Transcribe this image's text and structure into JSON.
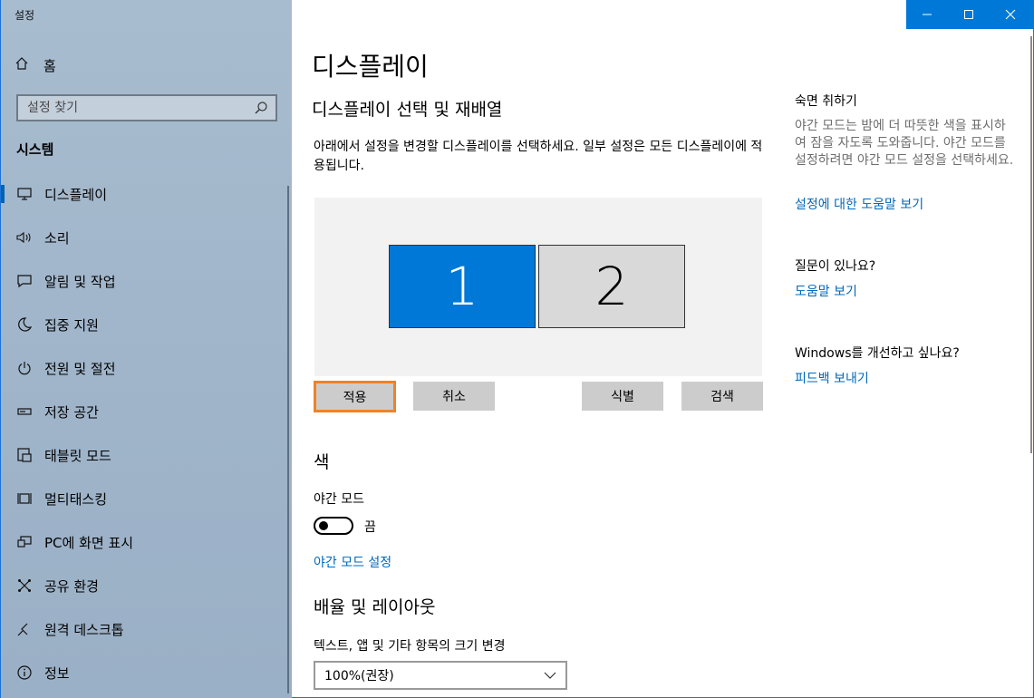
{
  "window": {
    "title": "설정",
    "controls": {
      "minimize": "—",
      "maximize": "☐",
      "close": "✕"
    }
  },
  "sidebar": {
    "home_label": "홈",
    "search_placeholder": "설정 찾기",
    "section_title": "시스템",
    "items": [
      {
        "label": "디스플레이",
        "icon": "monitor-icon",
        "active": true
      },
      {
        "label": "소리",
        "icon": "speaker-icon"
      },
      {
        "label": "알림 및 작업",
        "icon": "notification-icon"
      },
      {
        "label": "집중 지원",
        "icon": "moon-icon"
      },
      {
        "label": "전원 및 절전",
        "icon": "power-icon"
      },
      {
        "label": "저장 공간",
        "icon": "storage-icon"
      },
      {
        "label": "태블릿 모드",
        "icon": "tablet-icon"
      },
      {
        "label": "멀티태스킹",
        "icon": "multitask-icon"
      },
      {
        "label": "PC에 화면 표시",
        "icon": "project-icon"
      },
      {
        "label": "공유 환경",
        "icon": "share-icon"
      },
      {
        "label": "원격 데스크톱",
        "icon": "remote-icon"
      },
      {
        "label": "정보",
        "icon": "info-icon"
      }
    ]
  },
  "main": {
    "title": "디스플레이",
    "select_heading": "디스플레이 선택 및 재배열",
    "description": "아래에서 설정을 변경할 디스플레이를 선택하세요. 일부 설정은 모든 디스플레이에 적용됩니다.",
    "monitors": [
      "1",
      "2"
    ],
    "buttons": {
      "apply": "적용",
      "cancel": "취소",
      "identify": "식별",
      "detect": "검색"
    },
    "color_heading": "색",
    "night_light_label": "야간 모드",
    "night_light_state": "끔",
    "night_light_on": false,
    "night_light_link": "야간 모드 설정",
    "scale_heading": "배율 및 레이아웃",
    "scale_label": "텍스트, 앱 및 기타 항목의 크기 변경",
    "scale_value": "100%(권장)"
  },
  "right": {
    "sleep_heading": "숙면 취하기",
    "sleep_text": "야간 모드는 밤에 더 따뜻한 색을 표시하여 잠을 자도록 도와줍니다. 야간 모드를 설정하려면 야간 모드 설정을 선택하세요.",
    "sleep_link": "설정에 대한 도움말 보기",
    "question_heading": "질문이 있나요?",
    "help_link": "도움말 보기",
    "improve_heading": "Windows를 개선하고 싶나요?",
    "feedback_link": "피드백 보내기"
  },
  "colors": {
    "accent": "#0078d7",
    "highlight": "#f08226",
    "link": "#0067b8"
  }
}
